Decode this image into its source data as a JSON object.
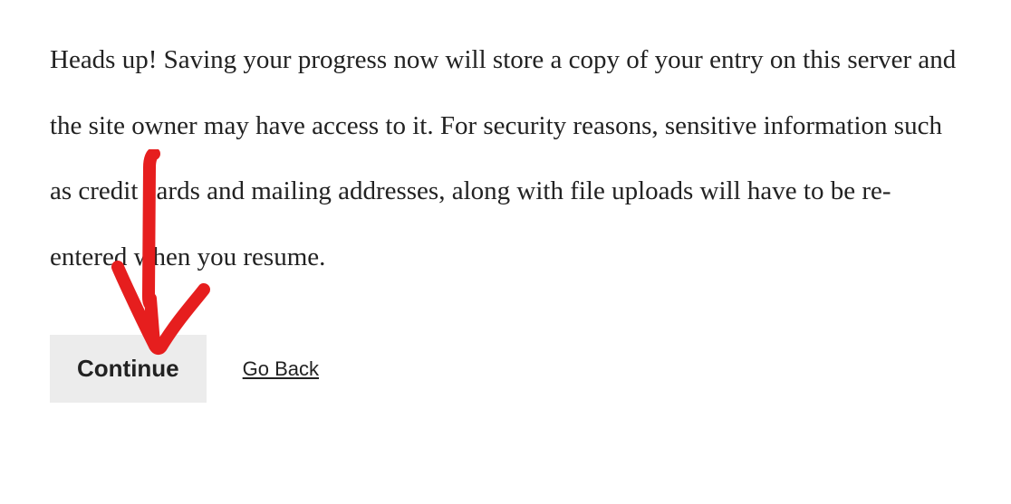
{
  "notice": {
    "text": "Heads up! Saving your progress now will store a copy of your entry on this server and the site owner may have access to it. For security reasons, sensitive information such as credit cards and mailing addresses, along with file uploads will have to be re-entered when you resume."
  },
  "buttons": {
    "continue_label": "Continue",
    "go_back_label": "Go Back"
  },
  "annotation": {
    "arrow_color": "#e61e1e"
  }
}
